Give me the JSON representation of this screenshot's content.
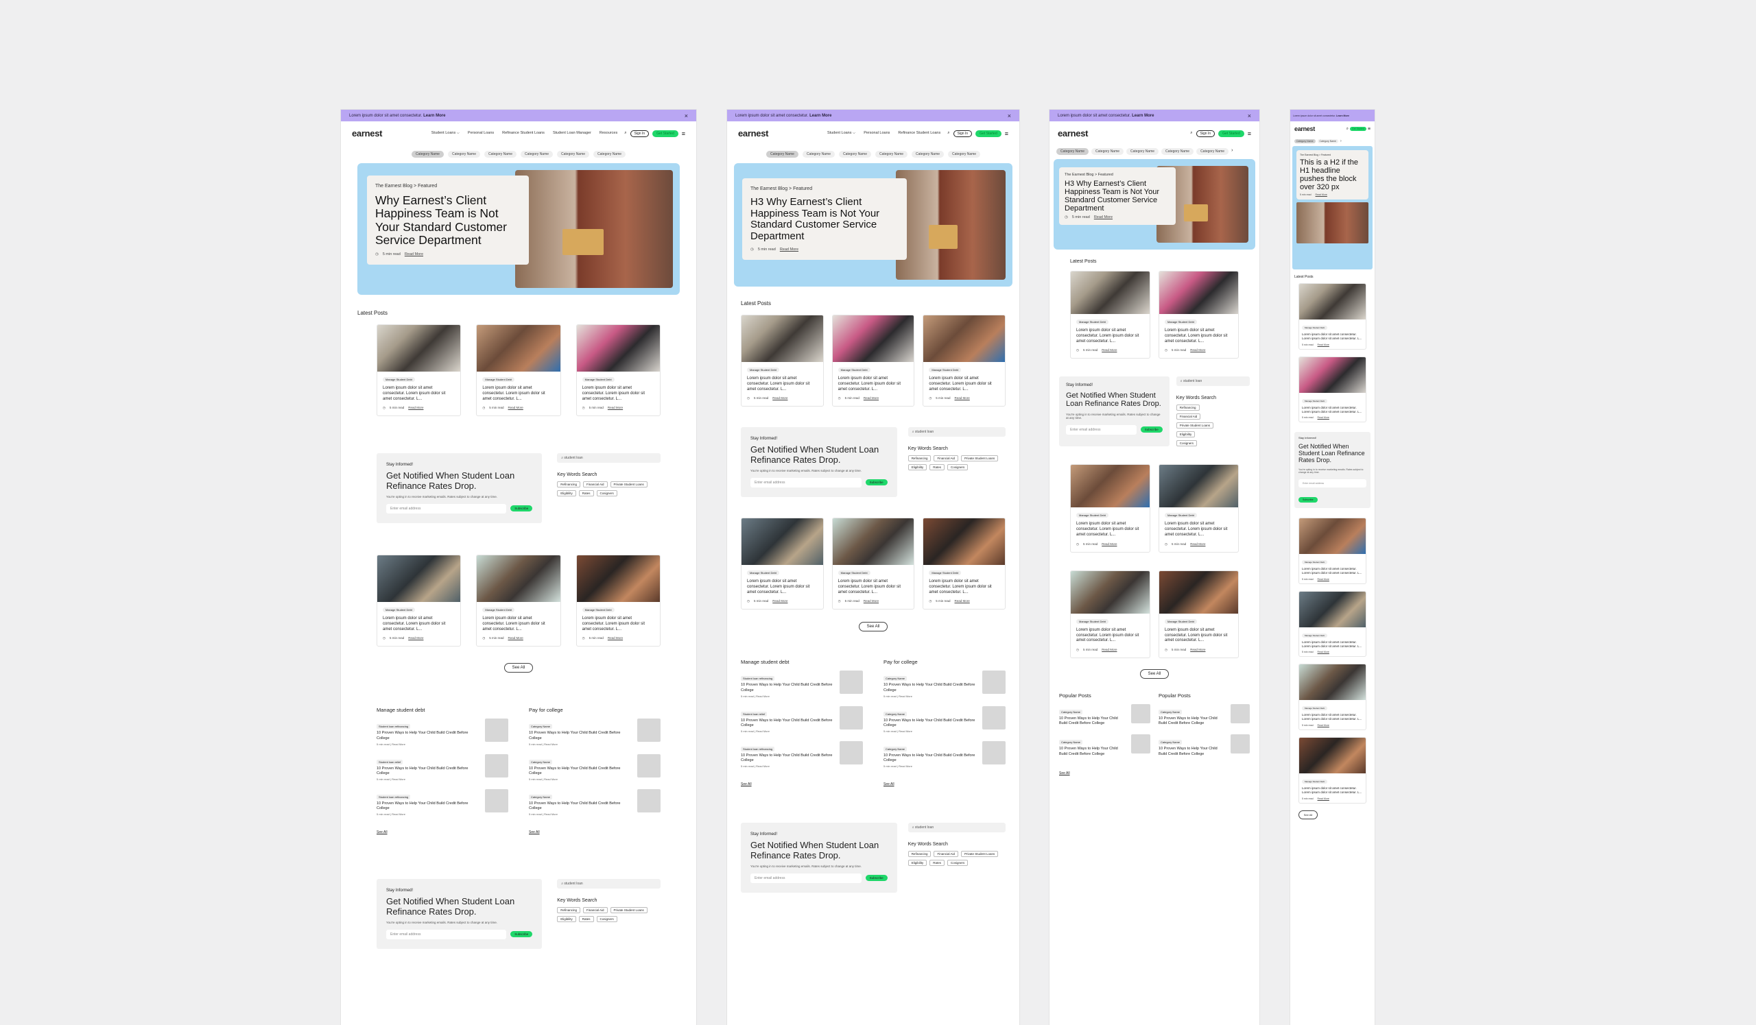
{
  "promo": {
    "text": "Lorem ipsum dolor sit amet consectetur.",
    "link": "Learn More"
  },
  "logo": "earnest",
  "nav": {
    "links": [
      "Student Loans ⌵",
      "Personal Loans",
      "Refinance Student Loans",
      "Student Loan Manager",
      "Resources"
    ],
    "sign_in": "Sign In",
    "get_started": "Get Started"
  },
  "categories": [
    "Category Name",
    "Category Name",
    "Category Name",
    "Category Name",
    "Category Name",
    "Category Name"
  ],
  "hero": {
    "eyebrow": "The Earnest Blog > Featured",
    "title_desktop": "Why Earnest’s Client Happiness Team is Not Your Standard Customer Service Department",
    "title_tablet": "H3 Why Earnest’s Client Happiness Team is Not Your Standard Customer Service Department",
    "title_mobile": "This is a H2  if the H1 headline pushes the block over 320 px",
    "read_time": "5 min read",
    "read_more": "Read More"
  },
  "latest_posts": {
    "heading": "Latest Posts",
    "tag": "Manage Student Debt",
    "excerpt": "Lorem ipsum dolor sit amet consectetur. Lorem ipsum dolor sit amet consectetur. L...",
    "read_time": "5 min read",
    "read_more": "Read More"
  },
  "newsletter": {
    "eyebrow": "Stay Informed!",
    "title": "Get Notified When Student Loan Refinance Rates Drop.",
    "disclaimer": "You're opting in to receive marketing emails. Rates subject to change at any time.",
    "email_placeholder": "Enter email address",
    "subscribe": "Subscribe"
  },
  "keywords": {
    "search_placeholder": "student loan",
    "heading": "Key Words Search",
    "chips": [
      "Refinancing",
      "Financial Aid",
      "Private Student Loans",
      "Eligibility",
      "Rates",
      "Cosigners"
    ]
  },
  "see_all": "See All",
  "topics": [
    {
      "heading": "Manage student debt",
      "tags": [
        "Student loan refinancing",
        "Student loan relief",
        "Student loan refinancing"
      ]
    },
    {
      "heading": "Pay for college",
      "tags": [
        "Category Name",
        "Category Name",
        "Category Name"
      ]
    }
  ],
  "topic_item": {
    "title": "10 Proven Ways to Help Your Child Build Credit Before College",
    "meta": "5 min read | Read More"
  },
  "popular_heading": "Popular Posts"
}
